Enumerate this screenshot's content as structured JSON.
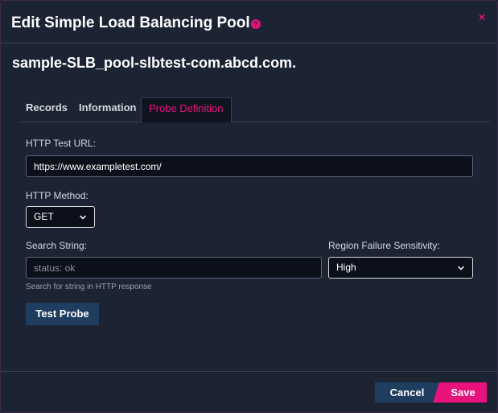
{
  "dialog": {
    "title": "Edit Simple Load Balancing Pool",
    "help_icon": "question-mark-icon",
    "close_label": "×",
    "pool_name": "sample-SLB_pool-slbtest-com.abcd.com."
  },
  "tabs": [
    {
      "label": "Records",
      "active": false
    },
    {
      "label": "Information",
      "active": false
    },
    {
      "label": "Probe Definition",
      "active": true
    }
  ],
  "form": {
    "http_test_url": {
      "label": "HTTP Test URL:",
      "value": "https://www.exampletest.com/"
    },
    "http_method": {
      "label": "HTTP Method:",
      "value": "GET"
    },
    "search_string": {
      "label": "Search String:",
      "value": "",
      "placeholder": "status: ok",
      "hint": "Search for string in HTTP response"
    },
    "region_failure_sensitivity": {
      "label": "Region Failure Sensitivity:",
      "value": "High"
    },
    "test_probe_label": "Test Probe"
  },
  "footer": {
    "cancel_label": "Cancel",
    "save_label": "Save"
  },
  "colors": {
    "background": "#1c2333",
    "accent": "#e8127c",
    "button_blue": "#1e3d5f",
    "input_bg": "#0c101a"
  }
}
